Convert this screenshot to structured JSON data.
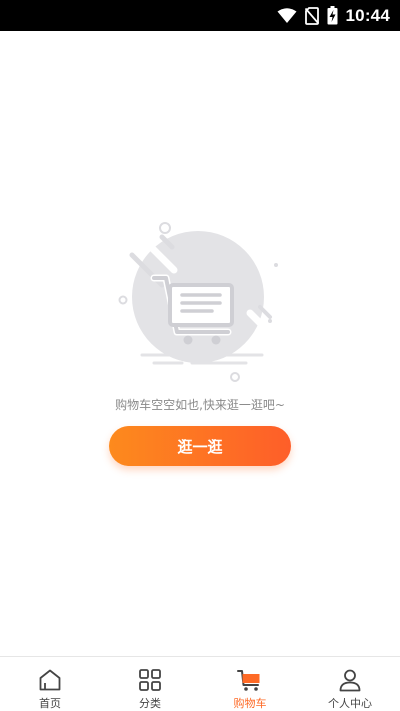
{
  "status_bar": {
    "time": "10:44",
    "icons": [
      "wifi-icon",
      "no-sim-icon",
      "battery-charging-icon"
    ]
  },
  "empty_state": {
    "illustration": "empty-cart-icon",
    "message": "购物车空空如也,快来逛一逛吧~",
    "button_label": "逛一逛"
  },
  "tab_bar": {
    "active_color": "#fe6a26",
    "items": [
      {
        "label": "首页",
        "icon": "home-icon"
      },
      {
        "label": "分类",
        "icon": "category-grid-icon"
      },
      {
        "label": "购物车",
        "icon": "cart-icon",
        "active": true
      },
      {
        "label": "个人中心",
        "icon": "user-icon"
      }
    ]
  },
  "colors": {
    "button_gradient_start": "#fd8a1d",
    "button_gradient_end": "#fe5e29",
    "illustration_gray": "#e3e3e6"
  }
}
